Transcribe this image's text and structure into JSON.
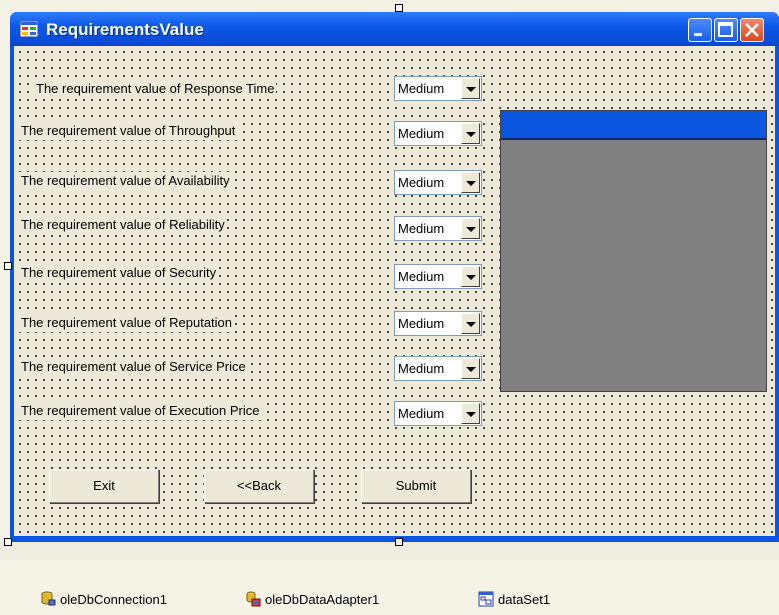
{
  "window": {
    "title": "RequirementsValue"
  },
  "requirements": [
    {
      "label": "The requirement value of Response Time",
      "value": "Medium"
    },
    {
      "label": "The requirement value of Throughput",
      "value": "Medium"
    },
    {
      "label": "The requirement value of Availability",
      "value": "Medium"
    },
    {
      "label": "The requirement value of Reliability",
      "value": "Medium"
    },
    {
      "label": "The requirement value of Security",
      "value": "Medium"
    },
    {
      "label": "The requirement value of Reputation",
      "value": "Medium"
    },
    {
      "label": "The requirement value of Service Price",
      "value": "Medium"
    },
    {
      "label": "The requirement value of Execution Price",
      "value": "Medium"
    }
  ],
  "buttons": {
    "exit": "Exit",
    "back": "<<Back",
    "submit": "Submit"
  },
  "tray": [
    {
      "label": "oleDbConnection1",
      "icon": "database-connection-icon"
    },
    {
      "label": "oleDbDataAdapter1",
      "icon": "data-adapter-icon"
    },
    {
      "label": "dataSet1",
      "icon": "dataset-icon"
    }
  ],
  "colors": {
    "titlebar": "#0d5ae8",
    "client": "#ece9d8",
    "grid_background": "#808080",
    "grid_header": "#0b57e0"
  }
}
